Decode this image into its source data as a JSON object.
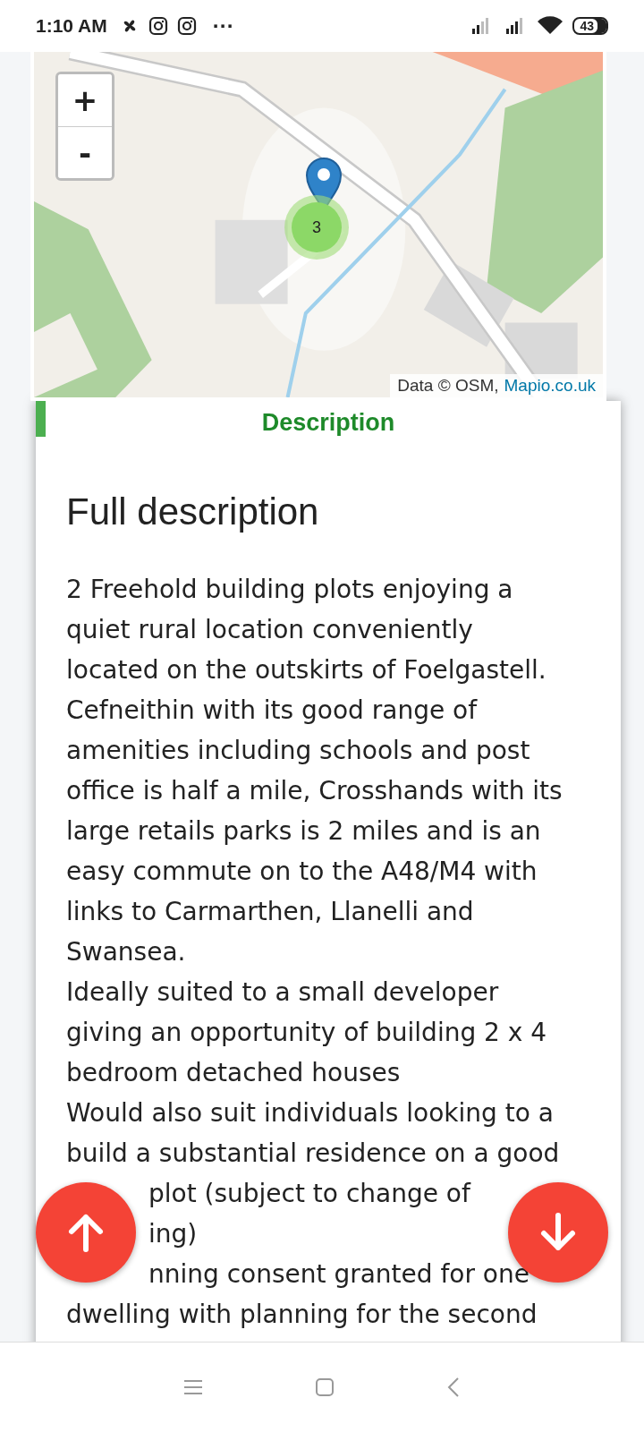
{
  "status_bar": {
    "time": "1:10 AM",
    "more": "···",
    "battery": "43"
  },
  "map": {
    "zoom_in": "+",
    "zoom_out": "-",
    "cluster_count": "3",
    "attribution": "Data © OSM,",
    "attribution_link": "Mapio.co.uk"
  },
  "section_tab": {
    "label": "Description",
    "selected": true
  },
  "heading": "Full description",
  "paragraphs": [
    {
      "kind": "paragraph",
      "text": "2 Freehold building plots enjoying a quiet rural location conveniently located on the outskirts of Foelgastell. Cefneithin with its good range of amenities including schools and post office is half a mile, Crosshands with its large retails parks is 2 miles and is an easy commute on to the A48/M4 with links to Carmarthen, Llanelli and Swansea."
    },
    {
      "kind": "paragraph",
      "text": "Ideally suited to a small developer giving an opportunity of building 2 x 4 bedroom detached houses"
    },
    {
      "kind": "paragraph",
      "text": "Would also suit individuals looking to a build a substantial residence on a good"
    },
    {
      "kind": "fragment",
      "text": "plot (subject to change of"
    },
    {
      "kind": "fragment",
      "text": "ing)"
    },
    {
      "kind": "fragment",
      "text": "nning consent granted for one"
    },
    {
      "kind": "paragraph",
      "text": "dwelling with planning for the second"
    }
  ],
  "fabs": [
    {
      "kind": "up"
    },
    {
      "kind": "down"
    }
  ]
}
